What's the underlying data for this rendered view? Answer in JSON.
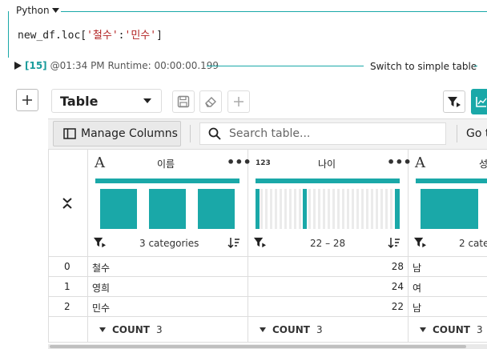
{
  "cell": {
    "language": "Python",
    "code_prefix": "new_df.loc[",
    "code_str1": "'철수'",
    "code_colon": ":",
    "code_str2": "'민수'",
    "code_suffix": "]",
    "run_index": "[15]",
    "run_info": "@01:34 PM Runtime: 00:00:00.199",
    "switch_label": "Switch to simple table"
  },
  "toolbar": {
    "view_select": "Table"
  },
  "grid_toolbar": {
    "manage_columns": "Manage Columns",
    "search_placeholder": "Search table...",
    "goto": "Go t"
  },
  "columns": [
    {
      "type_icon": "A",
      "title": "이름",
      "summary": "3 categories",
      "hist": [
        1,
        1,
        1
      ]
    },
    {
      "type_icon": "123",
      "title": "나이",
      "summary": "22 – 28"
    },
    {
      "type_icon": "A",
      "title": "성",
      "summary": "2 cate"
    }
  ],
  "rows": [
    {
      "index": "0",
      "name": "철수",
      "age": "28",
      "gender": "남"
    },
    {
      "index": "1",
      "name": "영희",
      "age": "24",
      "gender": "여"
    },
    {
      "index": "2",
      "name": "민수",
      "age": "22",
      "gender": "남"
    }
  ],
  "footer": {
    "count_label": "COUNT",
    "counts": [
      "3",
      "3",
      "3"
    ]
  },
  "colors": {
    "accent": "#1aa8a8"
  }
}
